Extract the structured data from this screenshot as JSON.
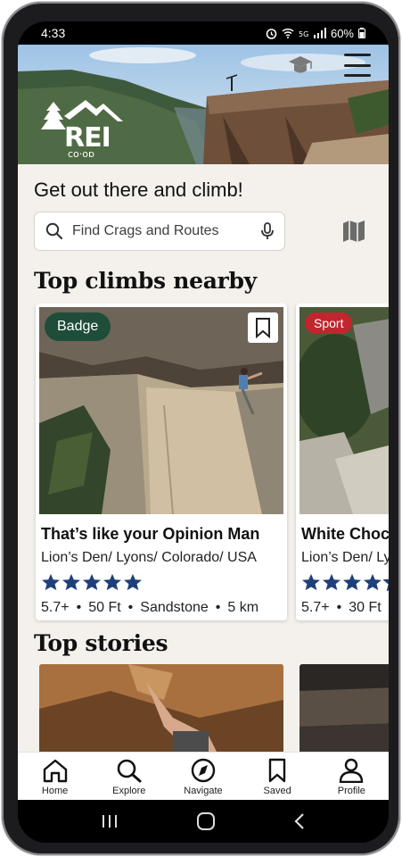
{
  "status_bar": {
    "time": "4:33",
    "battery": "60%"
  },
  "header": {
    "brand": "REI co-op"
  },
  "main": {
    "headline": "Get out there and climb!",
    "search": {
      "placeholder": "Find Crags and Routes"
    },
    "top_climbs": {
      "title": "Top climbs nearby",
      "cards": [
        {
          "badge": "Badge",
          "badge_color": "#1e4d3a",
          "name": "That’s like your Opinion Man",
          "location": "Lion’s Den/ Lyons/ Colorado/ USA",
          "rating_stars": 5,
          "grade": "5.7+",
          "height": "50 Ft",
          "rock": "Sandstone",
          "distance": "5 km"
        },
        {
          "badge": "Sport",
          "badge_color": "#c0262d",
          "name": "White Choc",
          "location": "Lion’s Den/ Ly",
          "rating_stars": 4.5,
          "grade": "5.7+",
          "height": "30 Ft"
        }
      ]
    },
    "top_stories": {
      "title": "Top stories"
    }
  },
  "tabs": [
    {
      "label": "Home",
      "icon": "home-icon"
    },
    {
      "label": "Explore",
      "icon": "search-icon"
    },
    {
      "label": "Navigate",
      "icon": "compass-icon"
    },
    {
      "label": "Saved",
      "icon": "bookmark-icon"
    },
    {
      "label": "Profile",
      "icon": "profile-icon"
    }
  ],
  "colors": {
    "star": "#1f3f7a",
    "background": "#f4f1ec"
  }
}
